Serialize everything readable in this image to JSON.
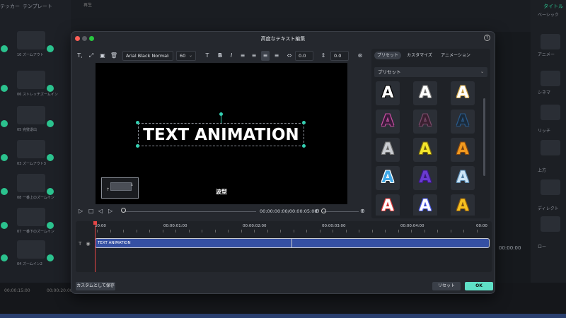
{
  "background": {
    "left_tabs": [
      "テッカー",
      "テンプレート"
    ],
    "thumb_labels": [
      "10 ズームアウト",
      "06 ストレッチズームイン",
      "05 完璧退出",
      "03 ズームアウト3",
      "08 一番上のズームイン",
      "07 一番下のズームイン",
      "04 ズームイン2"
    ],
    "top_label": "再生",
    "right_tab": "タイトル",
    "right_labels": [
      "ベーシック",
      "アニメー",
      "シネマ",
      "リッチ",
      "上方",
      "ディレクト",
      "ロー"
    ],
    "timecode": "00:00:00",
    "bottom_times": [
      "00:00:15:00",
      "00:00:20:00"
    ]
  },
  "dialog": {
    "title": "高度なテキスト編集",
    "help": "?",
    "colors": {
      "accent": "#5fe0c6",
      "close": "#ff5f57",
      "zoom": "#28c840",
      "clip": "#3550a3"
    }
  },
  "toolbar": {
    "text_tool": "T,",
    "font_family": "Arial Black Normal",
    "font_size": "60",
    "bold": "B",
    "italic": "I",
    "char_spacing": "0.0",
    "line_spacing": "0.0"
  },
  "preview": {
    "text": "TEXT ANIMATION",
    "caption": "波型"
  },
  "playback": {
    "timecode": "00:00:00:00/00:00:05:00"
  },
  "side_panel": {
    "tabs": [
      "プリセット",
      "カスタマイズ",
      "アニメーション"
    ],
    "active_tab": "プリセット",
    "dropdown_value": "プリセット",
    "preset_letter": "A",
    "presets": [
      {
        "fill": "#ffffff",
        "stroke": "#000000"
      },
      {
        "fill": "#ffffff",
        "stroke": "#777777"
      },
      {
        "fill": "#ffffff",
        "stroke": "#d4a84a"
      },
      {
        "fill": "#3a1a3a",
        "stroke": "#c44fa0"
      },
      {
        "fill": "#3a2030",
        "stroke": "#7a4a6a"
      },
      {
        "fill": "#1a2a3a",
        "stroke": "#2a5a8a"
      },
      {
        "fill": "#c9ccd1",
        "stroke": "#777777"
      },
      {
        "fill": "#f4e62a",
        "stroke": "#7a6a10"
      },
      {
        "fill": "#f29a1e",
        "stroke": "#8a4a10"
      },
      {
        "fill": "#3fa8e8",
        "stroke": "#ffffff"
      },
      {
        "fill": "#6a3ad0",
        "stroke": "#3a1a80"
      },
      {
        "fill": "#cde6f7",
        "stroke": "#5a8ab0"
      },
      {
        "fill": "#ffffff",
        "stroke": "#e33a3a"
      },
      {
        "fill": "#ffffff",
        "stroke": "#4a5ae8"
      },
      {
        "fill": "#f5c020",
        "stroke": "#8a5a10"
      }
    ]
  },
  "timeline": {
    "ruler": [
      "00:00",
      "00:00:01:00",
      "00:00:02:00",
      "00:00:03:00",
      "00:00:04:00",
      "00:00"
    ],
    "clip_label": "TEXT ANIMATION"
  },
  "footer": {
    "save_custom": "カスタムとして保存",
    "reset": "リセット",
    "ok": "OK"
  }
}
